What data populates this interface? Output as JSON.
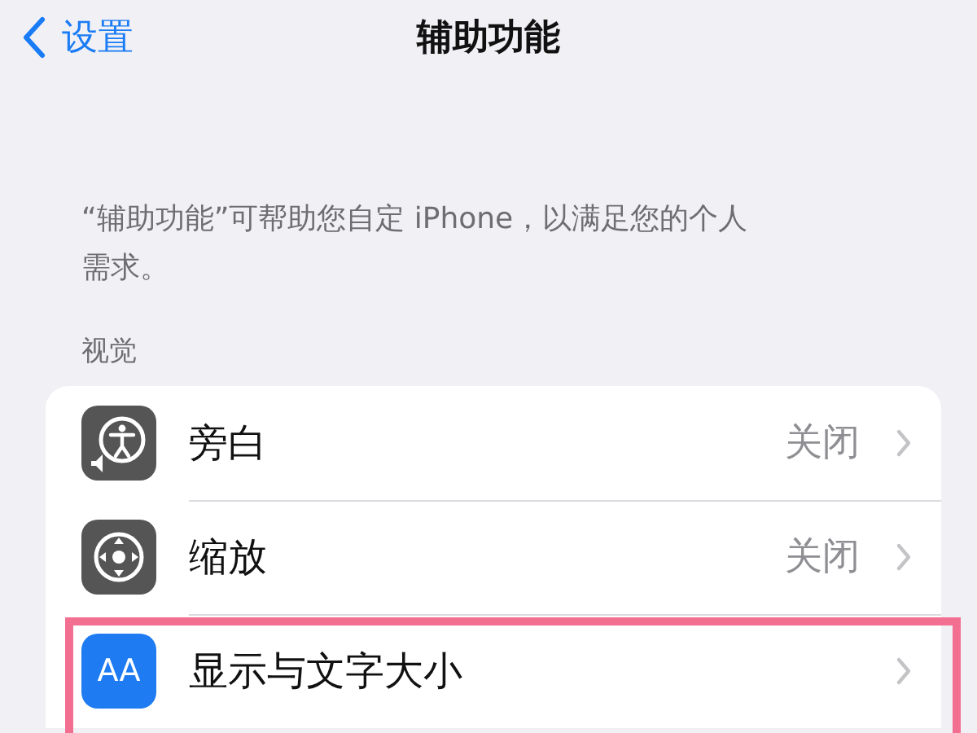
{
  "nav": {
    "back": "设置",
    "title": "辅助功能"
  },
  "description": "“辅助功能”可帮助您自定 iPhone，以满足您的个人需求。",
  "section": "视觉",
  "rows": [
    {
      "kind": "voiceover",
      "label": "旁白",
      "value": "关闭",
      "highlighted": false
    },
    {
      "kind": "zoom",
      "label": "缩放",
      "value": "关闭",
      "highlighted": false
    },
    {
      "kind": "text",
      "icon_text": "AA",
      "label": "显示与文字大小",
      "highlighted": true
    }
  ]
}
